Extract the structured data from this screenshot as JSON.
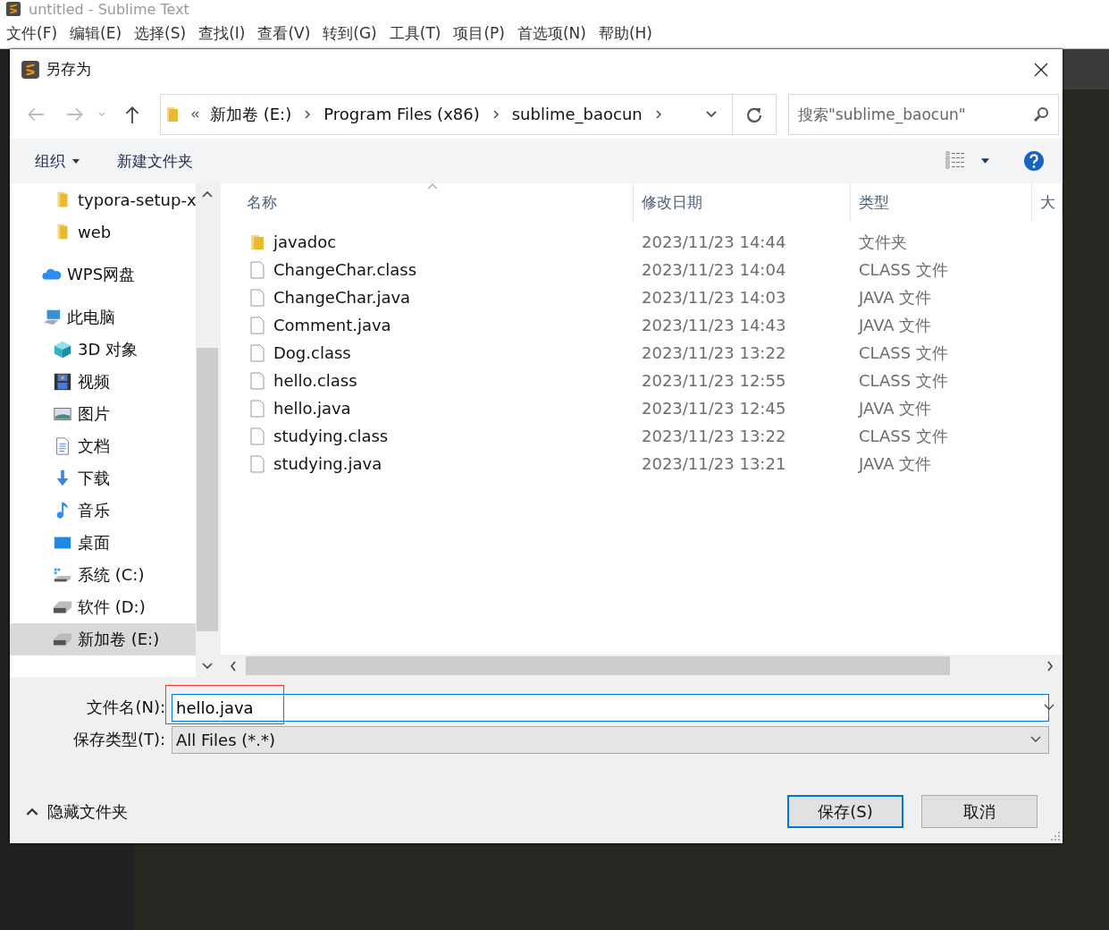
{
  "app": {
    "title": "untitled - Sublime Text",
    "menu": [
      "文件(F)",
      "编辑(E)",
      "选择(S)",
      "查找(I)",
      "查看(V)",
      "转到(G)",
      "工具(T)",
      "项目(P)",
      "首选项(N)",
      "帮助(H)"
    ]
  },
  "dialog": {
    "title": "另存为",
    "address": [
      "新加卷 (E:)",
      "Program Files (x86)",
      "sublime_baocun"
    ],
    "search": {
      "placeholder": "搜索\"sublime_baocun\""
    },
    "toolbar": {
      "organize": "组织",
      "new_folder": "新建文件夹"
    },
    "sidebar": {
      "items": [
        {
          "label": "typora-setup-x",
          "kind": "folder",
          "selected": false
        },
        {
          "label": "web",
          "kind": "folder",
          "selected": false
        },
        {
          "label": "WPS网盘",
          "kind": "cloud",
          "selected": false
        },
        {
          "label": "此电脑",
          "kind": "pc",
          "selected": false,
          "children": [
            {
              "label": "3D 对象",
              "kind": "cube",
              "selected": false
            },
            {
              "label": "视频",
              "kind": "video",
              "selected": false
            },
            {
              "label": "图片",
              "kind": "pictures",
              "selected": false
            },
            {
              "label": "文档",
              "kind": "document",
              "selected": false
            },
            {
              "label": "下载",
              "kind": "download",
              "selected": false
            },
            {
              "label": "音乐",
              "kind": "music",
              "selected": false
            },
            {
              "label": "桌面",
              "kind": "desktop",
              "selected": false
            },
            {
              "label": "系统 (C:)",
              "kind": "system-drive",
              "selected": false
            },
            {
              "label": "软件 (D:)",
              "kind": "drive",
              "selected": false
            },
            {
              "label": "新加卷 (E:)",
              "kind": "drive",
              "selected": true
            }
          ]
        }
      ]
    },
    "columns": [
      {
        "label": "名称",
        "sorted": true
      },
      {
        "label": "修改日期",
        "sorted": false
      },
      {
        "label": "类型",
        "sorted": false
      },
      {
        "label": "大",
        "sorted": false
      }
    ],
    "files": [
      {
        "name": "javadoc",
        "date": "2023/11/23 14:44",
        "type": "文件夹",
        "kind": "folder"
      },
      {
        "name": "ChangeChar.class",
        "date": "2023/11/23 14:04",
        "type": "CLASS 文件",
        "kind": "file"
      },
      {
        "name": "ChangeChar.java",
        "date": "2023/11/23 14:03",
        "type": "JAVA 文件",
        "kind": "file"
      },
      {
        "name": "Comment.java",
        "date": "2023/11/23 14:43",
        "type": "JAVA 文件",
        "kind": "file"
      },
      {
        "name": "Dog.class",
        "date": "2023/11/23 13:22",
        "type": "CLASS 文件",
        "kind": "file"
      },
      {
        "name": "hello.class",
        "date": "2023/11/23 12:55",
        "type": "CLASS 文件",
        "kind": "file"
      },
      {
        "name": "hello.java",
        "date": "2023/11/23 12:45",
        "type": "JAVA 文件",
        "kind": "file"
      },
      {
        "name": "studying.class",
        "date": "2023/11/23 13:22",
        "type": "CLASS 文件",
        "kind": "file"
      },
      {
        "name": "studying.java",
        "date": "2023/11/23 13:21",
        "type": "JAVA 文件",
        "kind": "file"
      }
    ],
    "filename": {
      "label": "文件名(N):",
      "value": "hello.java"
    },
    "filetype": {
      "label": "保存类型(T):",
      "value": "All Files (*.*)"
    },
    "hide_folders": "隐藏文件夹",
    "buttons": [
      {
        "label": "保存(S)",
        "default": true
      },
      {
        "label": "取消",
        "default": false
      }
    ]
  }
}
